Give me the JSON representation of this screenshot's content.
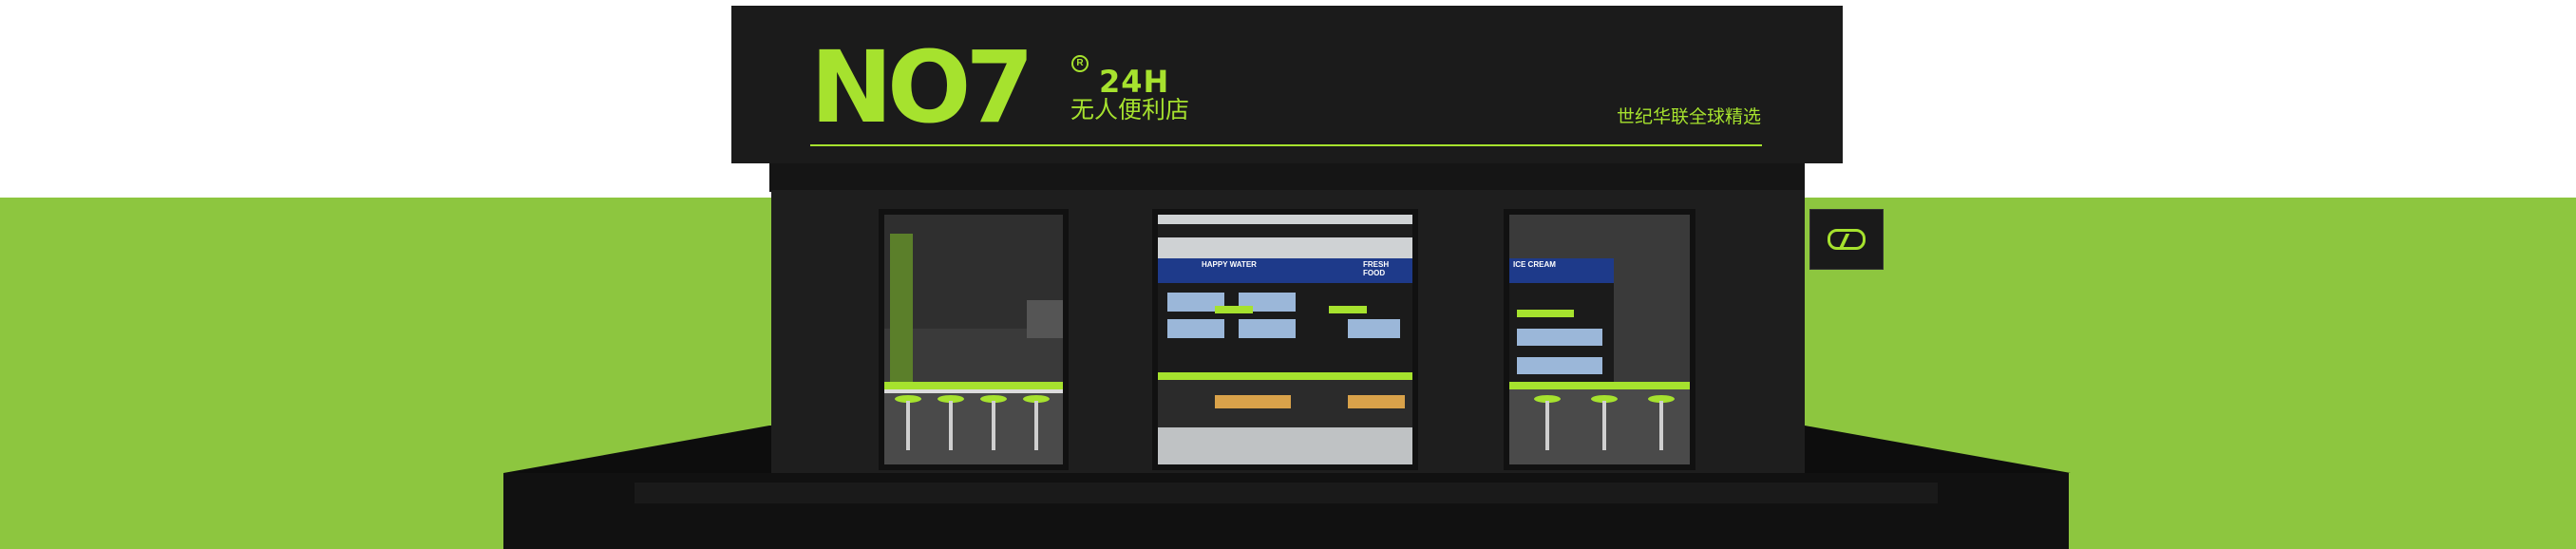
{
  "storefront": {
    "brand": "NO7",
    "hours": "24H",
    "tagline": "无人便利店",
    "slogan": "世纪华联全球精选"
  },
  "shelf_signs": {
    "happy_water": "HAPPY WATER",
    "fresh_food": "FRESH FOOD",
    "ice_cream": "ICE CREAM"
  },
  "colors": {
    "brand_green": "#a6e22e",
    "ground_green": "#8dc63f",
    "building": "#1b1b1b"
  },
  "icons": {
    "blade_sign": "no7-bolt-logo-icon"
  }
}
